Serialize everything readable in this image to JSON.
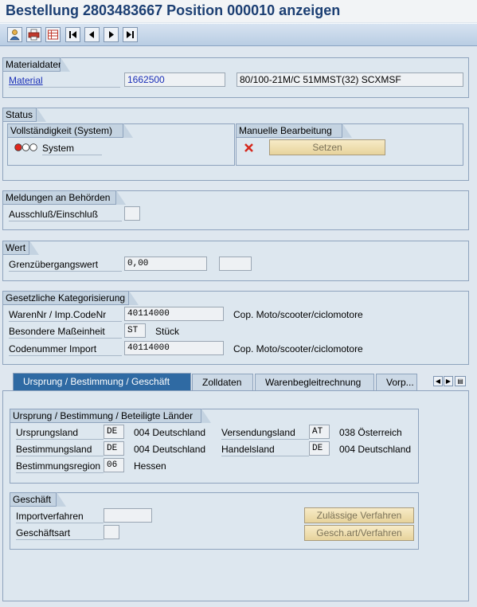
{
  "title": "Bestellung 2803483667 Position 000010 anzeigen",
  "toolbar": [
    "person-icon",
    "printer-icon",
    "table-icon",
    "first-page-icon",
    "previous-page-icon",
    "next-page-icon",
    "last-page-icon"
  ],
  "materialdaten": {
    "header": "Materialdaten",
    "material_label": "Material",
    "material_value": "1662500",
    "material_text": "80/100-21M/C 51MMST(32) SCXMSF"
  },
  "status": {
    "header": "Status",
    "vollst_header": "Vollständigkeit (System)",
    "system_label": "System",
    "manuell_header": "Manuelle Bearbeitung",
    "setzen_label": "Setzen"
  },
  "meldungen": {
    "header": "Meldungen an Behörden",
    "ausschluss_label": "Ausschluß/Einschluß",
    "ausschluss_value": ""
  },
  "wert": {
    "header": "Wert",
    "grenz_label": "Grenzübergangswert",
    "grenz_value": "0,00",
    "currency_value": ""
  },
  "kategorisierung": {
    "header": "Gesetzliche Kategorisierung",
    "warennr_label": "WarenNr / Imp.CodeNr",
    "warennr_value": "40114000",
    "warennr_text": "Cop. Moto/scooter/ciclomotore",
    "mass_label": "Besondere Maßeinheit",
    "mass_value": "ST",
    "mass_text": "Stück",
    "code_label": "Codenummer Import",
    "code_value": "40114000",
    "code_text": "Cop. Moto/scooter/ciclomotore"
  },
  "tabs": {
    "tab1": "Ursprung / Bestimmung / Geschäft",
    "tab2": "Zolldaten",
    "tab3": "Warenbegleitrechnung",
    "tab4": "Vorp..."
  },
  "ursprung": {
    "header": "Ursprung / Bestimmung / Beteiligte Länder",
    "ursprungsland_label": "Ursprungsland",
    "ursprungsland_value": "DE",
    "ursprungsland_text": "004 Deutschland",
    "versendungsland_label": "Versendungsland",
    "versendungsland_value": "AT",
    "versendungsland_text": "038 Österreich",
    "bestimmungsland_label": "Bestimmungsland",
    "bestimmungsland_value": "DE",
    "bestimmungsland_text": "004 Deutschland",
    "handelsland_label": "Handelsland",
    "handelsland_value": "DE",
    "handelsland_text": "004 Deutschland",
    "region_label": "Bestimmungsregion",
    "region_value": "06",
    "region_text": "Hessen"
  },
  "geschaeft": {
    "header": "Geschäft",
    "import_label": "Importverfahren",
    "import_value": "",
    "art_label": "Geschäftsart",
    "art_value": "",
    "zulaessige_label": "Zulässige Verfahren",
    "geschart_label": "Gesch.art/Verfahren"
  }
}
